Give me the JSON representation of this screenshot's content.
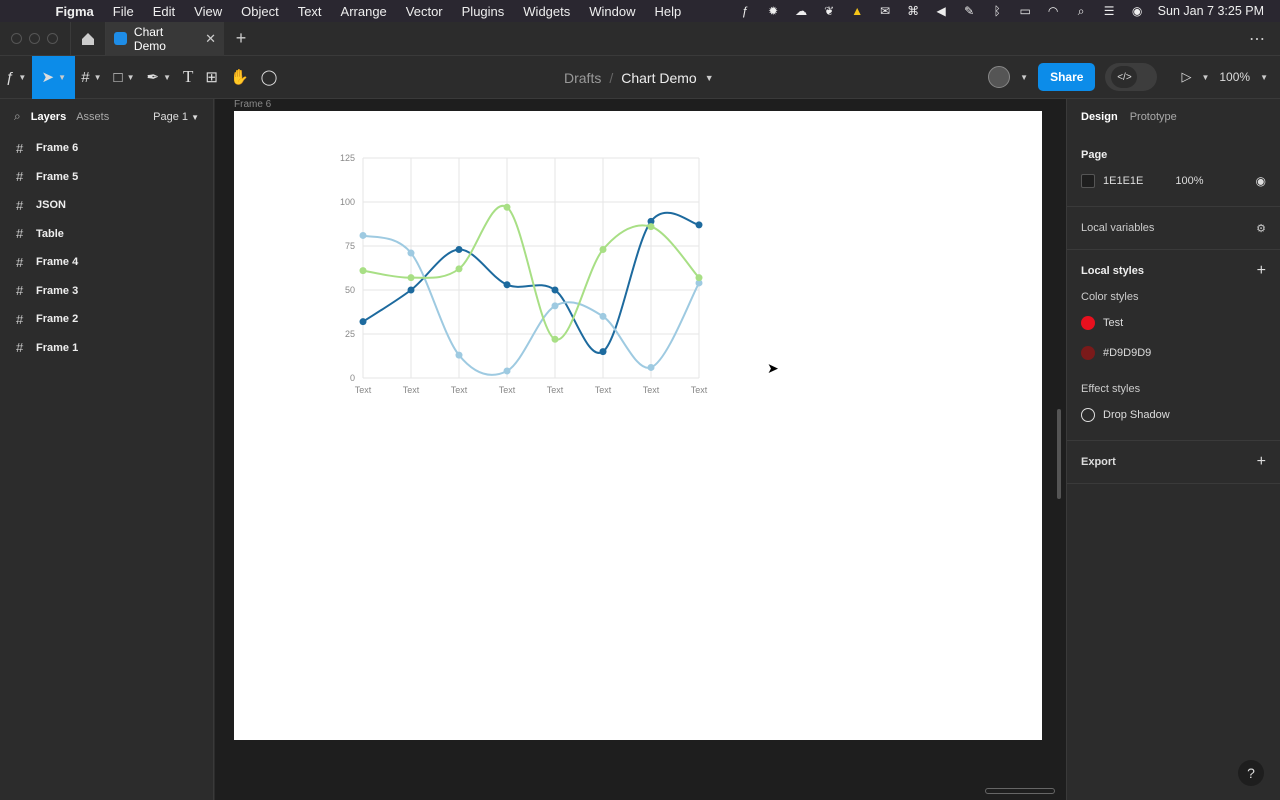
{
  "menubar": {
    "app": "Figma",
    "items": [
      "File",
      "Edit",
      "View",
      "Object",
      "Text",
      "Arrange",
      "Vector",
      "Plugins",
      "Widgets",
      "Window",
      "Help"
    ],
    "clock": "Sun Jan 7  3:25 PM"
  },
  "tabs": {
    "file_tab": "Chart Demo"
  },
  "toolbar": {
    "breadcrumb_parent": "Drafts",
    "breadcrumb_sep": "/",
    "file_name": "Chart Demo",
    "share_label": "Share",
    "dev_mode_glyph": "</>",
    "zoom": "100%"
  },
  "left_panel": {
    "tab_layers": "Layers",
    "tab_assets": "Assets",
    "page_select": "Page 1",
    "layers": [
      "Frame 6",
      "Frame 5",
      "JSON",
      "Table",
      "Frame 4",
      "Frame 3",
      "Frame 2",
      "Frame 1"
    ]
  },
  "canvas": {
    "frame_label": "Frame 6"
  },
  "right_panel": {
    "tab_design": "Design",
    "tab_prototype": "Prototype",
    "page_title": "Page",
    "page_color": "1E1E1E",
    "page_opacity": "100%",
    "local_variables": "Local variables",
    "local_styles": "Local styles",
    "color_styles": "Color styles",
    "colors": [
      {
        "name": "Test",
        "hex": "#e8101e"
      },
      {
        "name": "#D9D9D9",
        "hex": "#7a1a1a"
      }
    ],
    "effect_styles": "Effect styles",
    "effect": "Drop Shadow",
    "export": "Export"
  },
  "help_glyph": "?",
  "chart_data": {
    "type": "line",
    "categories": [
      "Text",
      "Text",
      "Text",
      "Text",
      "Text",
      "Text",
      "Text",
      "Text"
    ],
    "ylim": [
      0,
      125
    ],
    "yticks": [
      "125",
      "100",
      "75",
      "50",
      "25",
      "0"
    ],
    "grid": true,
    "series": [
      {
        "color": "#1d6a9e",
        "values": [
          32,
          50,
          73,
          53,
          50,
          15,
          89,
          87
        ]
      },
      {
        "color": "#9ecae1",
        "values": [
          81,
          71,
          13,
          4,
          41,
          35,
          6,
          54
        ]
      },
      {
        "color": "#a8df85",
        "values": [
          61,
          57,
          62,
          97,
          22,
          73,
          86,
          57
        ]
      }
    ]
  }
}
